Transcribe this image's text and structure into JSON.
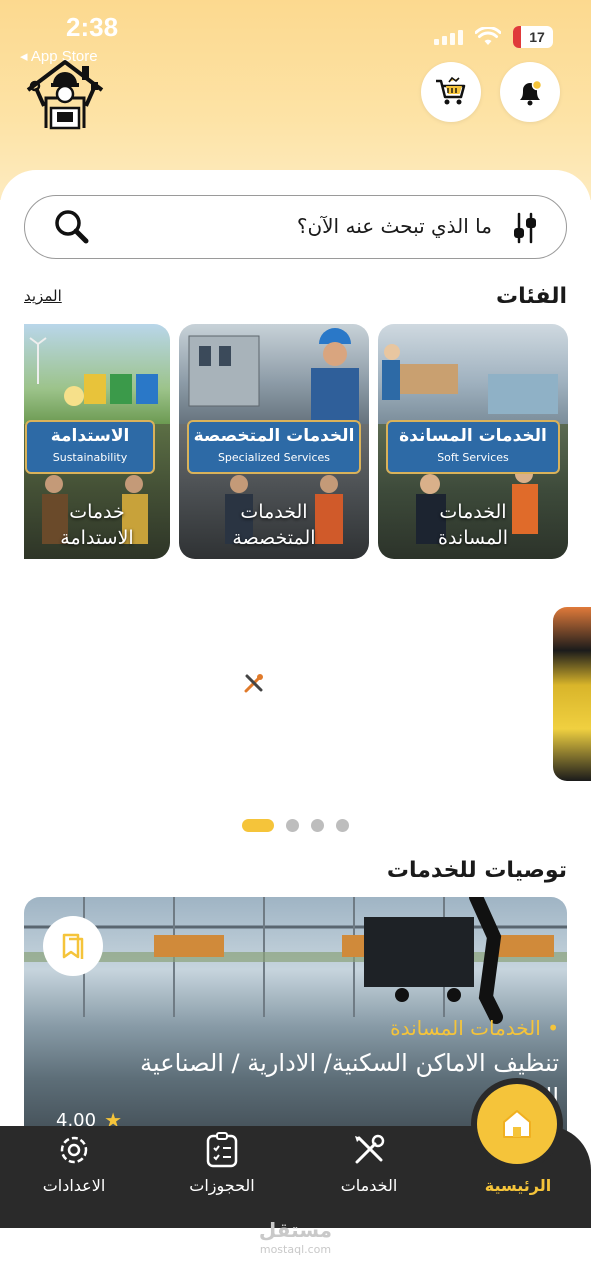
{
  "status_bar": {
    "time": "2:38",
    "back_label": "◂ App Store",
    "battery": "17"
  },
  "header": {
    "cart_icon": "cart-icon",
    "notification_icon": "bell-icon"
  },
  "search": {
    "placeholder": "ما الذي تبحث عنه الآن؟"
  },
  "categories": {
    "title": "الفئات",
    "more_label": "المزيد",
    "items": [
      {
        "banner_ar": "الخدمات المساندة",
        "banner_en": "Soft Services",
        "label_line1": "الخدمات",
        "label_line2": "المساندة"
      },
      {
        "banner_ar": "الخدمات المتخصصة",
        "banner_en": "Specialized Services",
        "label_line1": "الخدمات",
        "label_line2": "المتخصصة"
      },
      {
        "banner_ar": "الاستدامة",
        "banner_en": "Sustainability",
        "label_line1": "خدمات",
        "label_line2": "الاستدامة"
      }
    ]
  },
  "carousel": {
    "pages": 4,
    "active_page": 1
  },
  "recommendations": {
    "title": "توصيات للخدمات",
    "card": {
      "category": "• الخدمات المساندة",
      "title": "تنظيف الاماكن السكنية/ الادارية / الصناعية اليومي",
      "rating": "4.00"
    }
  },
  "bottom_nav": {
    "home": "الرئيسية",
    "services": "الخدمات",
    "bookings": "الحجوزات",
    "settings": "الاعدادات"
  },
  "watermark": {
    "main": "مستقل",
    "sub": "mostaql.com"
  },
  "colors": {
    "accent": "#f5c43a",
    "nav_bg": "#2a2a2a",
    "banner_blue": "#2d6aa6"
  }
}
